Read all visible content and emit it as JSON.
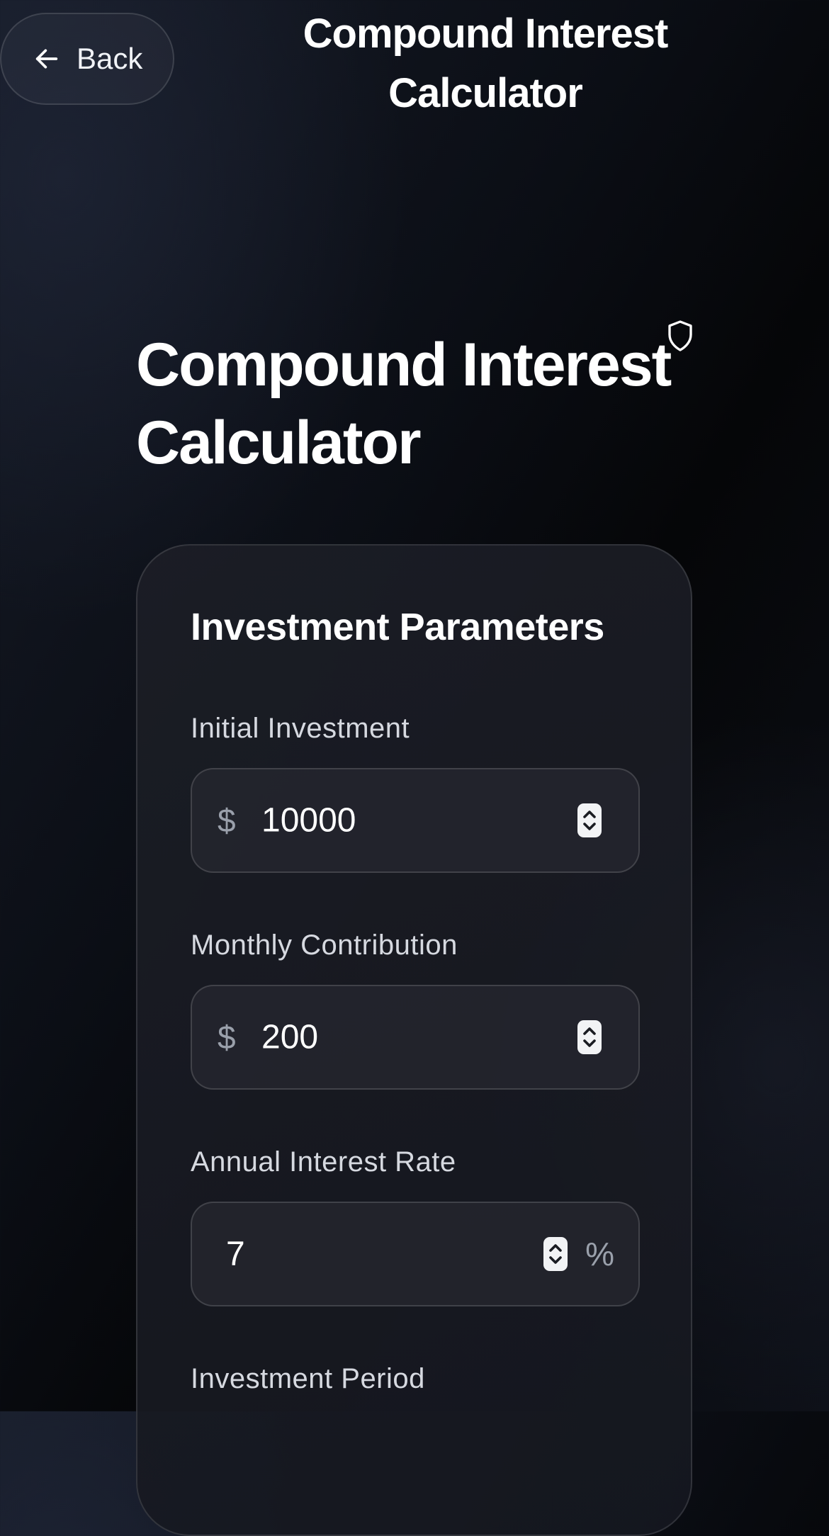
{
  "header": {
    "back_label": "Back",
    "title": "Compound Interest Calculator"
  },
  "hero": {
    "title": "Compound Interest Calculator"
  },
  "card": {
    "title": "Investment Parameters",
    "fields": [
      {
        "label": "Initial Investment",
        "prefix": "$",
        "value": "10000"
      },
      {
        "label": "Monthly Contribution",
        "prefix": "$",
        "value": "200"
      },
      {
        "label": "Annual Interest Rate",
        "value": "7",
        "suffix": "%"
      },
      {
        "label": "Investment Period"
      }
    ]
  },
  "icons": {
    "back": "arrow-left-icon",
    "shield": "shield-icon",
    "stepper": "stepper-icon"
  }
}
